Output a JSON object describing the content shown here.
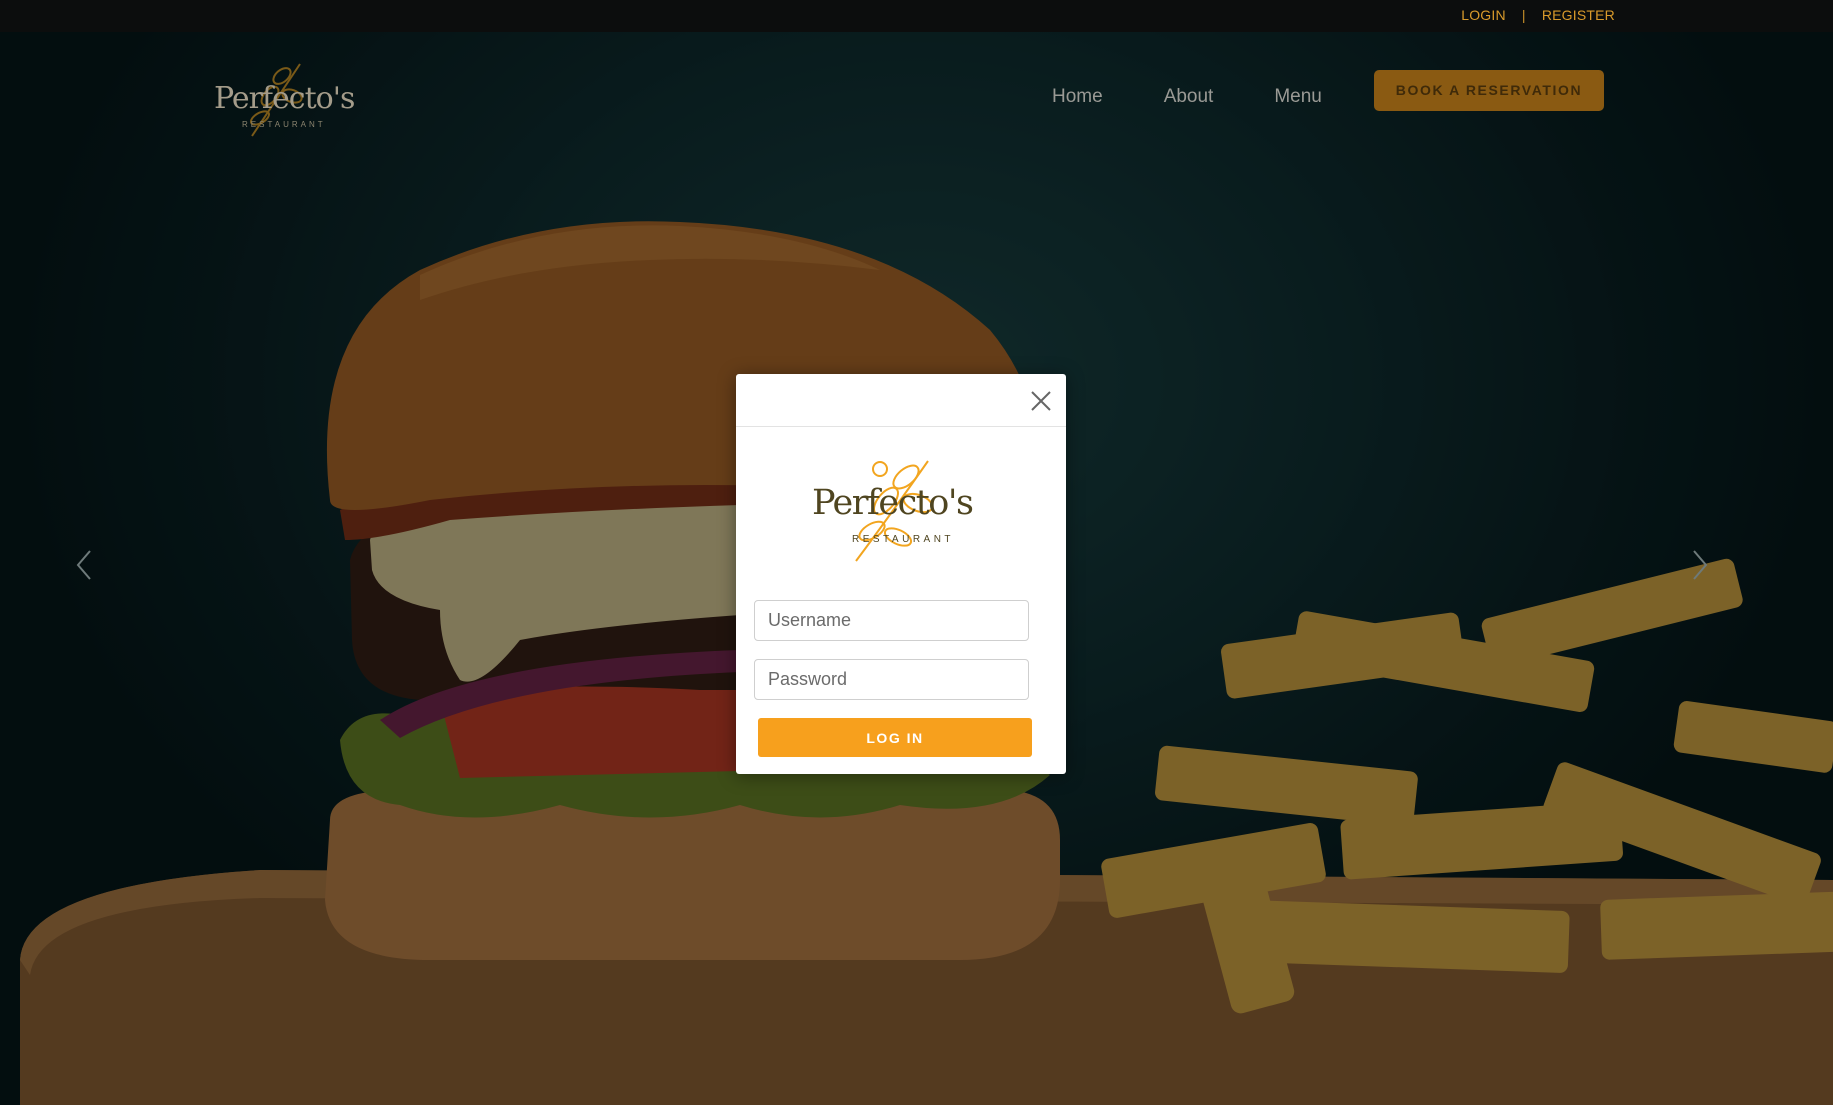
{
  "topbar": {
    "login_label": "LOGIN",
    "separator": "|",
    "register_label": "REGISTER"
  },
  "brand": {
    "name": "Perfecto's",
    "subtitle": "RESTAURANT"
  },
  "nav": {
    "items": [
      {
        "label": "Home"
      },
      {
        "label": "About"
      },
      {
        "label": "Menu"
      }
    ],
    "reserve_label": "BOOK A RESERVATION"
  },
  "hero": {
    "left_arrow_icon": "chevron-left-icon",
    "right_arrow_icon": "chevron-right-icon"
  },
  "modal": {
    "close_icon": "close-icon",
    "logo_name": "Perfecto's",
    "logo_subtitle": "RESTAURANT",
    "username_placeholder": "Username",
    "password_placeholder": "Password",
    "login_button_label": "LOG IN"
  },
  "colors": {
    "accent": "#f7a01d",
    "topbar_text": "#d99a2b",
    "reserve_button": "#8a5a12",
    "background": "#0d2b2e"
  }
}
